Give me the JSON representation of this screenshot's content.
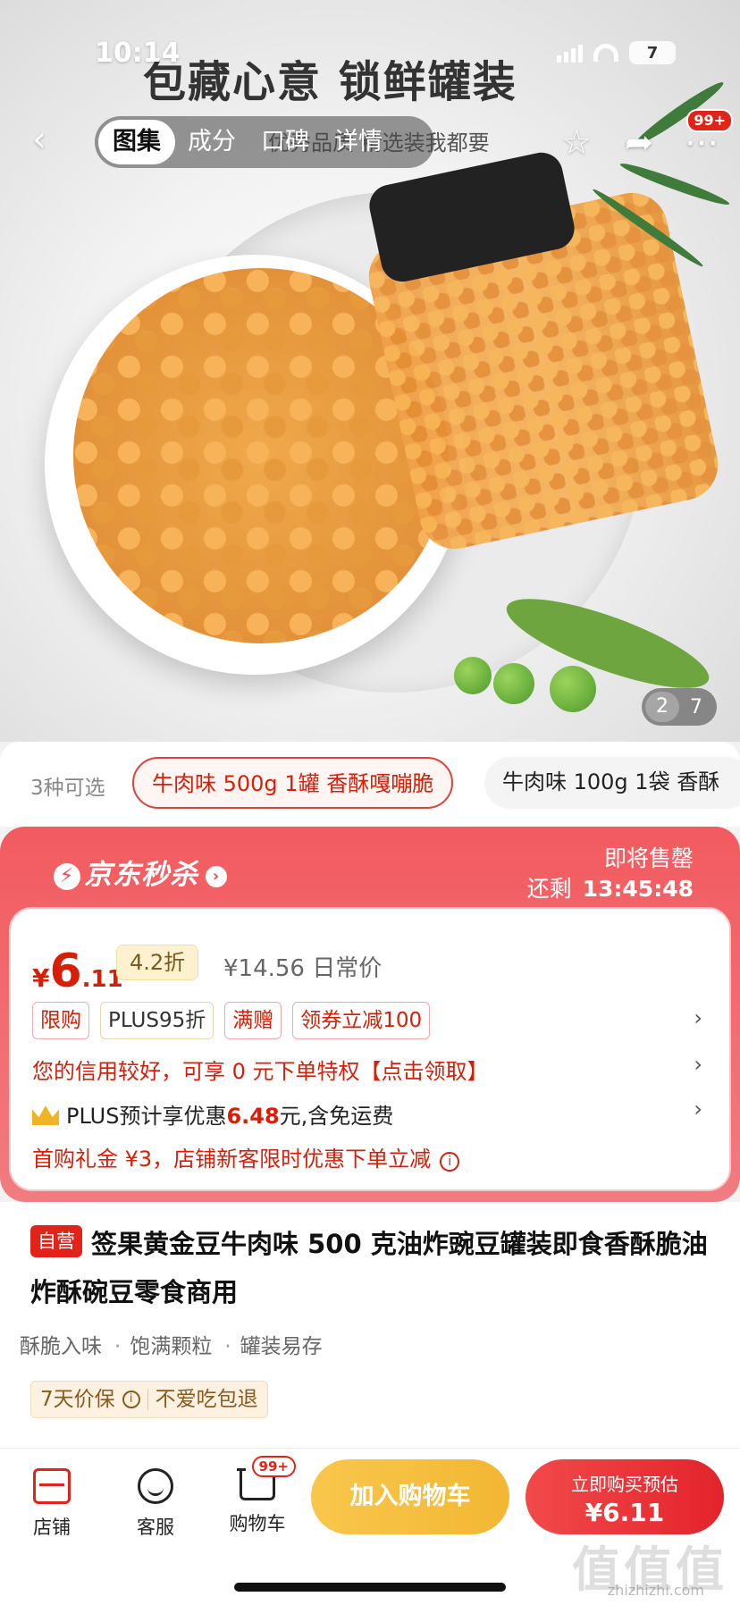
{
  "status_bar": {
    "time": "10:14",
    "battery": "7"
  },
  "hero": {
    "title": "包藏心意 锁鲜罐装",
    "subtitle": "优秀品质 精选装我都要",
    "image_counter": {
      "current": "2",
      "total": "7"
    }
  },
  "nav": {
    "tabs": [
      {
        "label": "图集",
        "active": true
      },
      {
        "label": "成分"
      },
      {
        "label": "口碑"
      },
      {
        "label": "详情"
      }
    ],
    "more_badge": "99+"
  },
  "variants": {
    "count_label": "3种可选",
    "options": [
      {
        "label": "牛肉味 500g 1罐 香酥嘎嘣脆",
        "selected": true
      },
      {
        "label": "牛肉味 100g 1袋 香酥"
      }
    ]
  },
  "flash_sale": {
    "brand": "京东秒杀",
    "soon_label": "即将售罄",
    "remaining_label": "还剩",
    "countdown": "13:45:48",
    "price": {
      "currency": "¥",
      "integer": "6",
      "decimal": ".11"
    },
    "discount": "4.2折",
    "original_price": "¥14.56 日常价",
    "tags": [
      "限购",
      "PLUS95折",
      "满赠",
      "领券立减100"
    ],
    "credit_text": "您的信用较好，可享 0 元下单特权【点击领取】",
    "plus_prefix": "PLUS预计享优惠",
    "plus_amount": "6.48",
    "plus_suffix": "元,含免运费",
    "gift_text": "首购礼金 ¥3，店铺新客限时优惠下单立减"
  },
  "product": {
    "self_tag": "自营",
    "title": "签果黄金豆牛肉味 500 克油炸豌豆罐装即食香酥脆油炸酥碗豆零食商用",
    "features": [
      "酥脆入味",
      "饱满颗粒",
      "罐装易存"
    ],
    "guarantee": [
      "7天价保",
      "不爱吃包退"
    ]
  },
  "bottom_bar": {
    "shop_label": "店铺",
    "service_label": "客服",
    "cart_label": "购物车",
    "cart_badge": "99+",
    "add_cart_label": "加入购物车",
    "buy_label": "立即购买预估",
    "buy_price": "¥6.11"
  },
  "watermark": {
    "main": "值值值",
    "sub": "zhizhizhi.com"
  },
  "colors": {
    "accent_red": "#e2231a",
    "flash_sale_red": "#f25b5f",
    "cart_yellow": "#f2b733"
  }
}
